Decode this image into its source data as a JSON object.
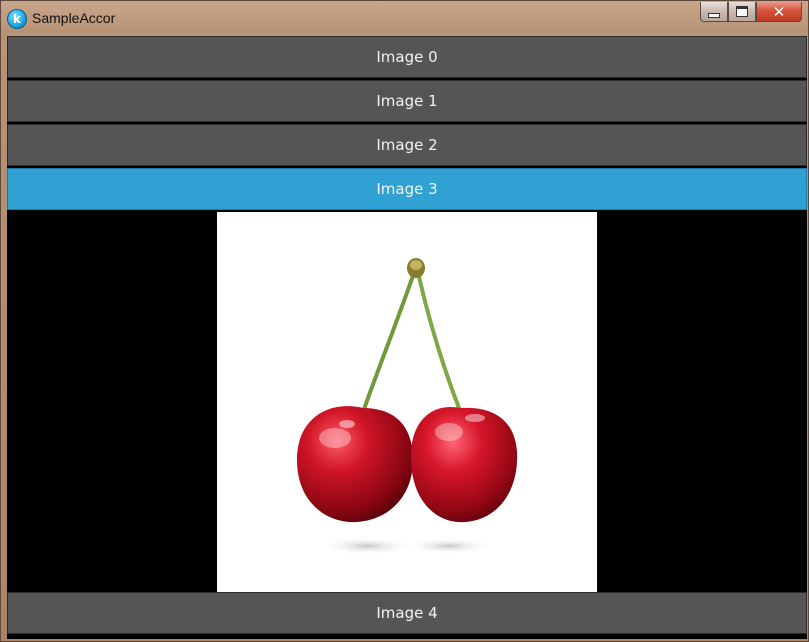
{
  "window": {
    "title": "SampleAccor",
    "app_icon_letter": "k",
    "close_glyph": "✕"
  },
  "accordion": {
    "items": [
      {
        "label": "Image 0"
      },
      {
        "label": "Image 1"
      },
      {
        "label": "Image 2"
      },
      {
        "label": "Image 3"
      },
      {
        "label": "Image 4"
      }
    ],
    "active_index": 3,
    "active_color": "#2fa2d3",
    "inactive_color": "#555555"
  },
  "content": {
    "image_subject": "cherries"
  }
}
